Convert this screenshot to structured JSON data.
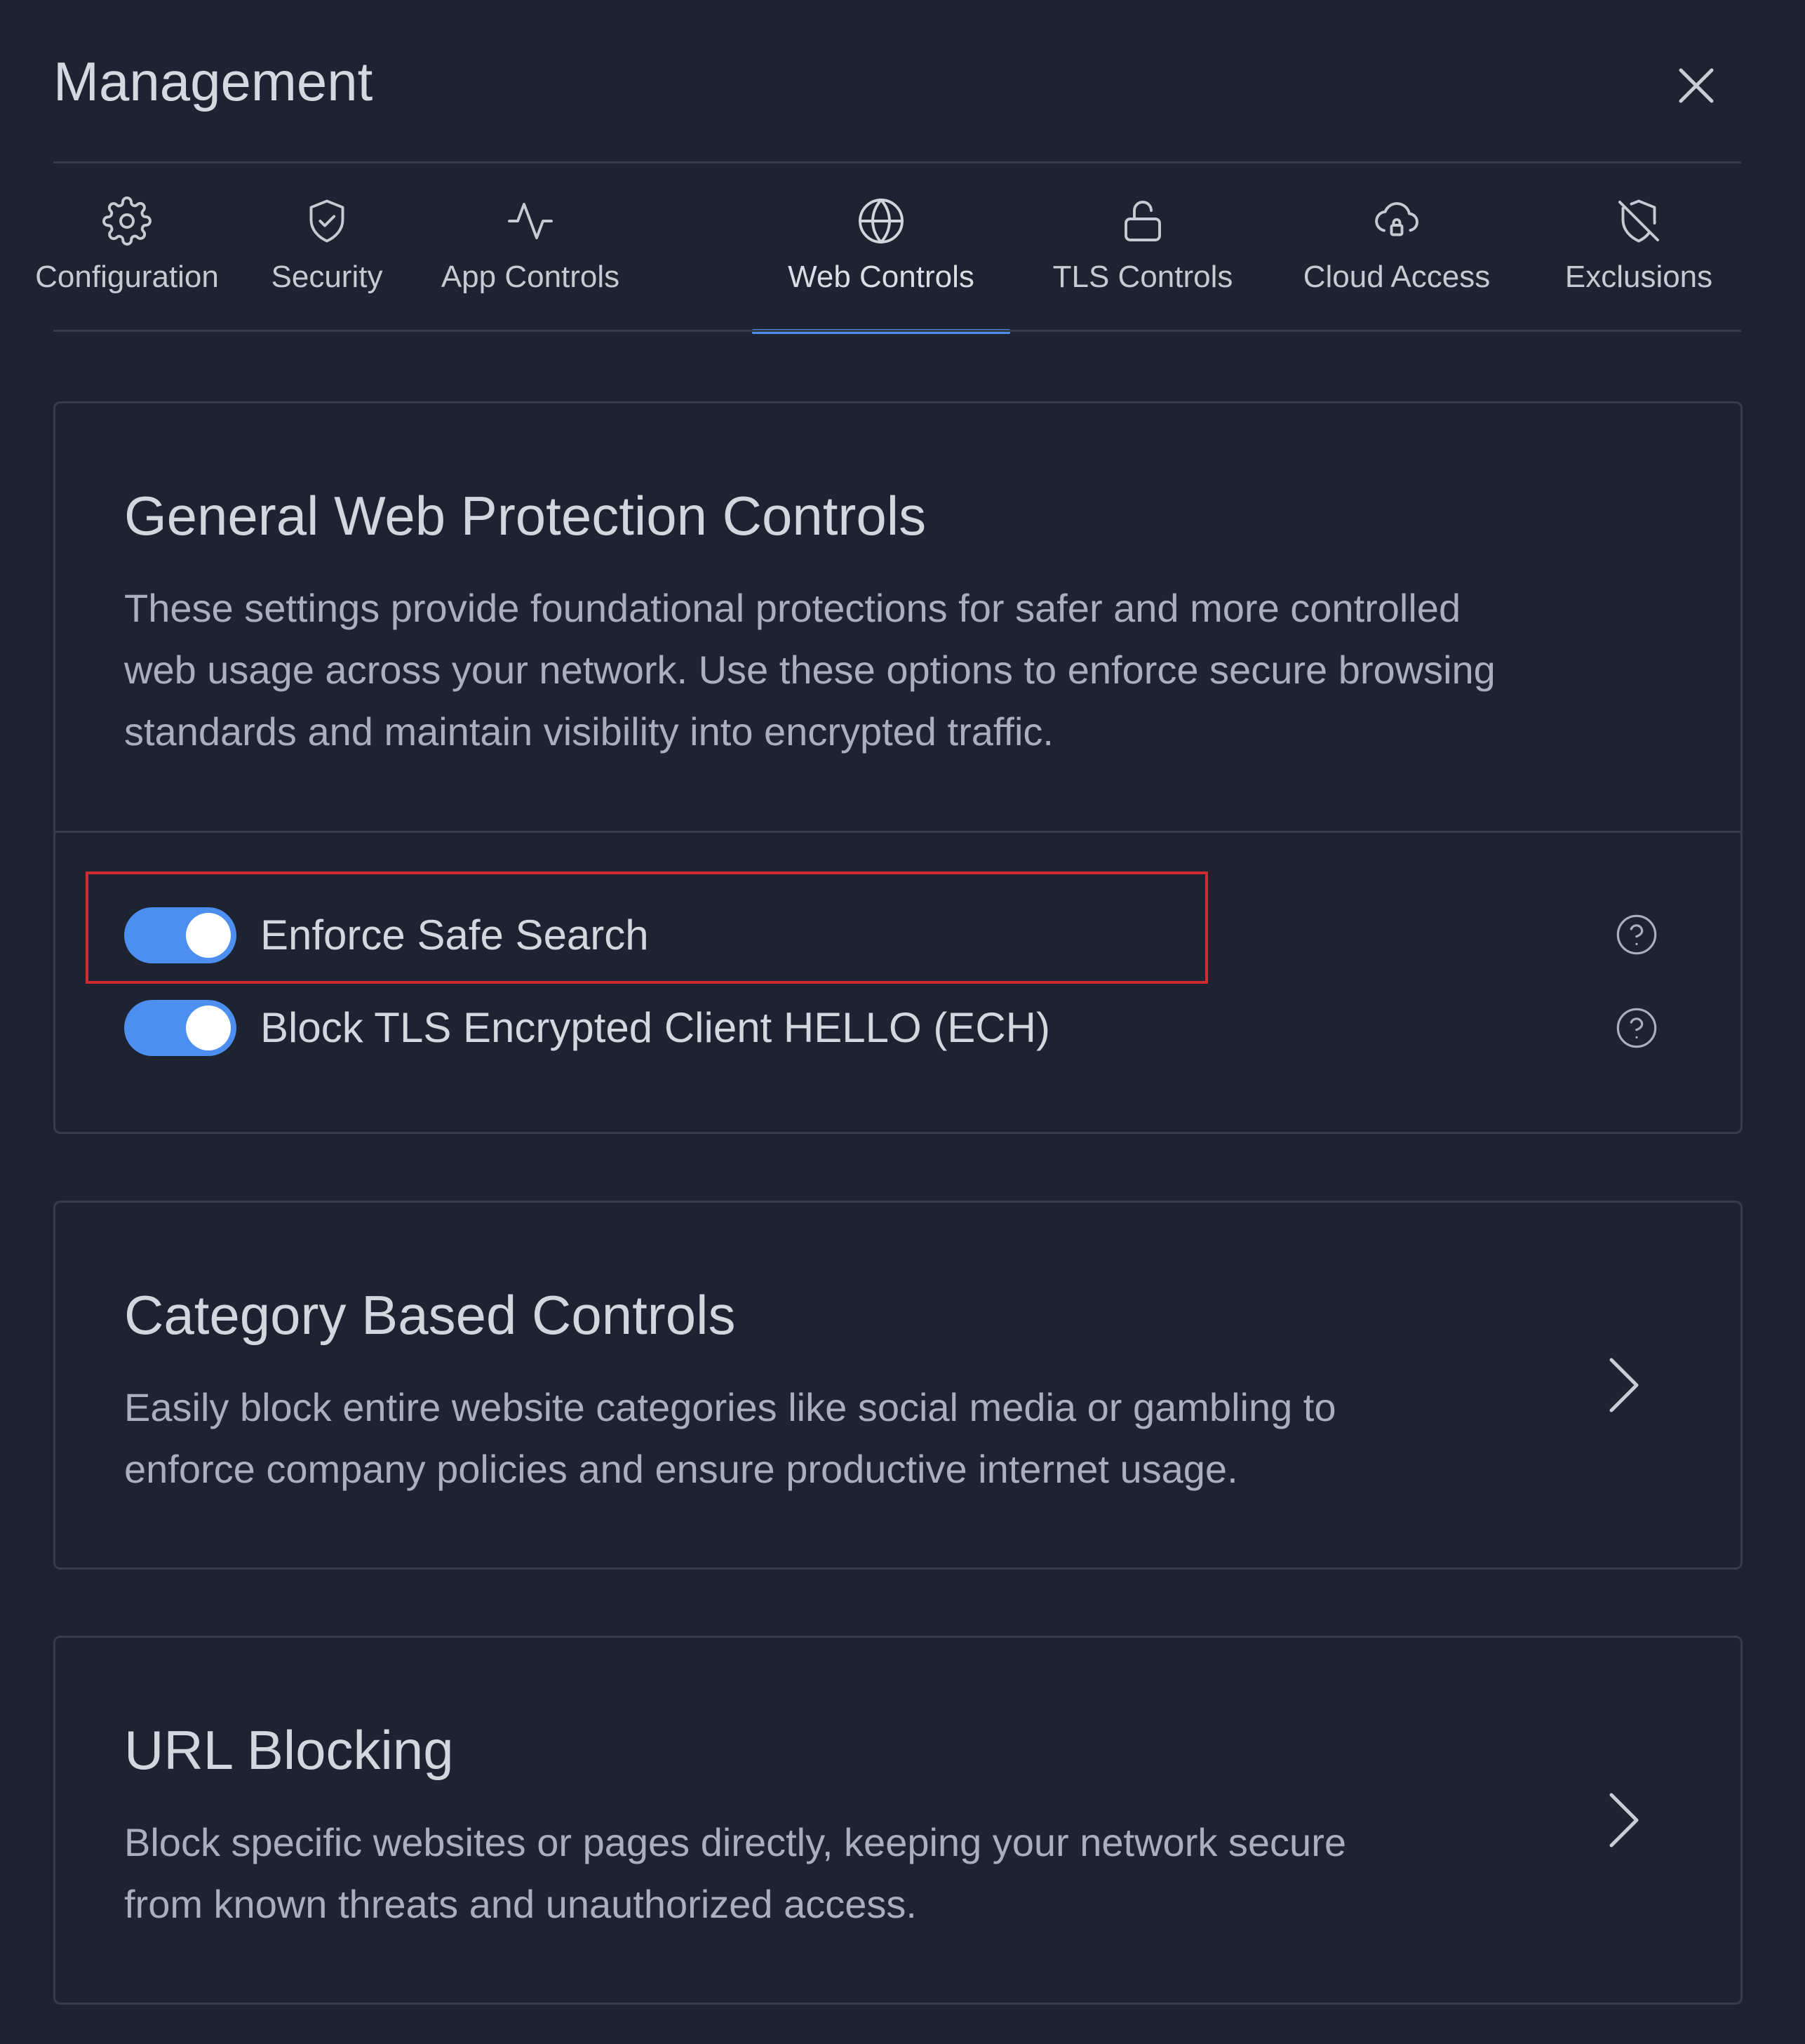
{
  "header": {
    "title": "Management",
    "close_icon": "close-icon"
  },
  "tabs": [
    {
      "label": "Configuration",
      "icon": "gear-icon",
      "active": false
    },
    {
      "label": "Security",
      "icon": "shield-check-icon",
      "active": false
    },
    {
      "label": "App Controls",
      "icon": "activity-icon",
      "active": false
    },
    {
      "label": "Web Controls",
      "icon": "globe-icon",
      "active": true
    },
    {
      "label": "TLS Controls",
      "icon": "unlock-icon",
      "active": false
    },
    {
      "label": "Cloud Access",
      "icon": "cloud-lock-icon",
      "active": false
    },
    {
      "label": "Exclusions",
      "icon": "shield-off-icon",
      "active": false
    }
  ],
  "general": {
    "title": "General Web Protection Controls",
    "description_lines": [
      "These settings provide foundational protections for safer and more controlled",
      "web usage across your network. Use these options to enforce secure browsing",
      "standards and maintain visibility into encrypted traffic."
    ],
    "toggles": [
      {
        "label": "Enforce Safe Search",
        "on": true,
        "help_icon": "help-circle-icon"
      },
      {
        "label": "Block TLS Encrypted Client HELLO (ECH)",
        "on": true,
        "help_icon": "help-circle-icon"
      }
    ]
  },
  "category": {
    "title": "Category Based Controls",
    "description_lines": [
      "Easily block entire website categories like social media or gambling to",
      "enforce company policies and ensure productive internet usage."
    ],
    "chevron_icon": "chevron-right-icon"
  },
  "url_blocking": {
    "title": "URL Blocking",
    "description_lines": [
      "Block specific websites or pages directly, keeping your network secure",
      "from known threats and unauthorized access."
    ],
    "chevron_icon": "chevron-right-icon"
  },
  "colors": {
    "background": "#1d2330",
    "accent": "#4b8fea",
    "highlight_border": "#d12a32"
  }
}
